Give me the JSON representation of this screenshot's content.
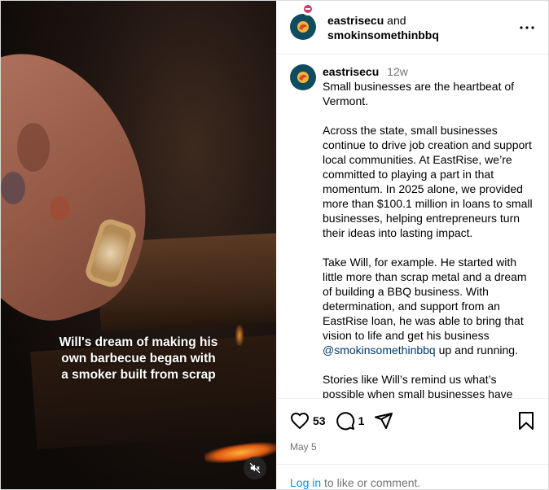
{
  "media": {
    "caption_lines": [
      "Will's dream of making his",
      "own barbecue began with",
      "a smoker built from scrap"
    ],
    "mute_icon": "muted-speaker-icon"
  },
  "header": {
    "user1": "eastrisecu",
    "and_text": "and",
    "user2": "smokinsomethinbbq",
    "more_icon": "more-options-icon"
  },
  "post": {
    "username": "eastrisecu",
    "age": "12w",
    "paragraphs": [
      "Small businesses are the heartbeat of Vermont.",
      "Across the state, small businesses continue to drive job creation and support local communities. At EastRise, we’re committed to playing a part in that momentum. In 2025 alone, we provided more than $100.1 million in loans to small businesses, helping entrepreneurs turn their ideas into lasting impact.",
      "Take Will, for example. He started with little more than scrap metal and a dream of building a BBQ business. With determination, and support from an EastRise loan, he was able to bring that vision to life and get his business",
      "Stories like Will’s remind us what’s possible when small businesses have"
    ],
    "mention": "@smokinsomethinbbq",
    "after_mention": "up and running."
  },
  "actions": {
    "likes": "53",
    "comments": "1",
    "date": "May 5",
    "login_link": "Log in",
    "login_rest": "to like or comment."
  },
  "colors": {
    "avatar_bg": "#0f4d5e",
    "link": "#0095f6",
    "mention": "#00376b",
    "muted": "#737373"
  }
}
